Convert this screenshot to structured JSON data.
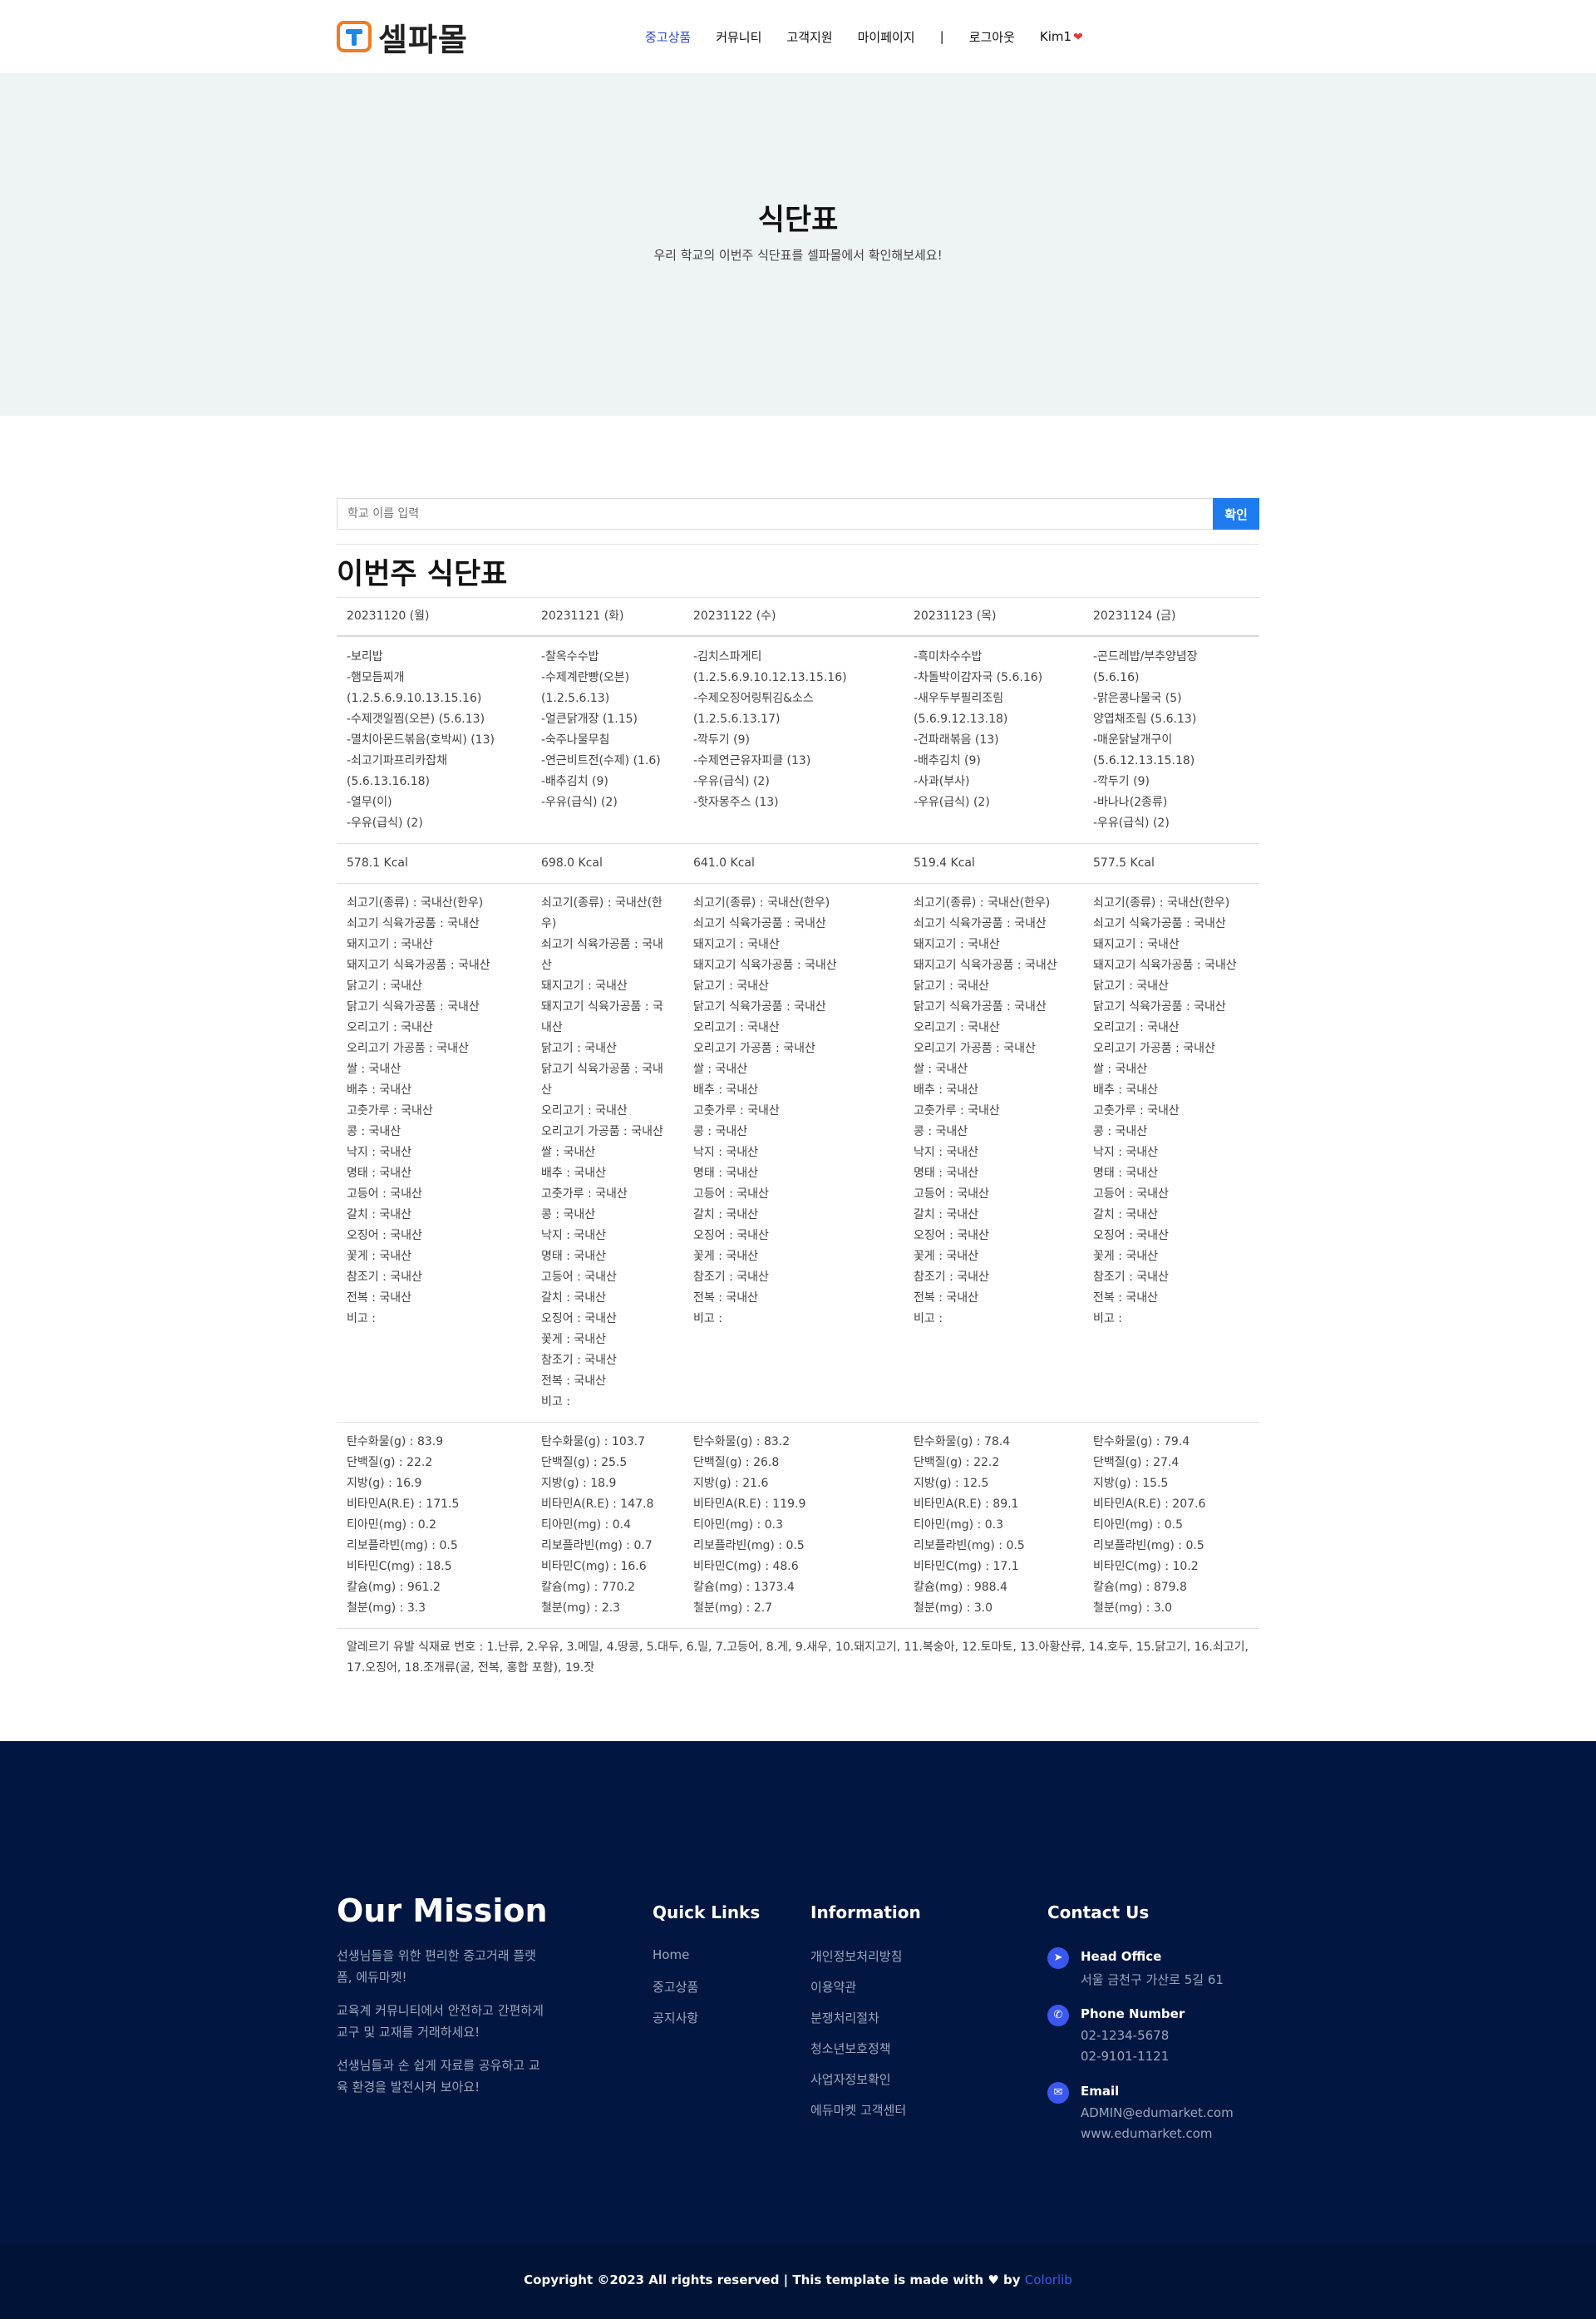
{
  "header": {
    "logo_text": "셀파몰",
    "nav": [
      "중고상품",
      "커뮤니티",
      "고객지원",
      "마이페이지",
      "|",
      "로그아웃",
      "Kim1"
    ]
  },
  "hero": {
    "title": "식단표",
    "subtitle": "우리 학교의 이번주 식단표를 셀파몰에서 확인해보세요!"
  },
  "search": {
    "placeholder": "학교 이름 입력",
    "button": "확인"
  },
  "section_title": "이번주 식단표",
  "days": [
    {
      "date": "20231120 (월)",
      "menu": [
        "-보리밥",
        "-햄모듬찌개",
        "(1.2.5.6.9.10.13.15.16)",
        "-수제갯일찜(오븐) (5.6.13)",
        "-멸치아몬드볶음(호박씨) (13)",
        "-쇠고기파프리카잡채",
        "(5.6.13.16.18)",
        "-열무(이)",
        "-우유(급식) (2)"
      ],
      "kcal": "578.1 Kcal",
      "origin": [
        "쇠고기(종류) : 국내산(한우)",
        "쇠고기 식육가공품 : 국내산",
        "돼지고기 : 국내산",
        "돼지고기 식육가공품 : 국내산",
        "닭고기 : 국내산",
        "닭고기 식육가공품 : 국내산",
        "오리고기 : 국내산",
        "오리고기 가공품 : 국내산",
        "쌀 : 국내산",
        "배추 : 국내산",
        "고춧가루 : 국내산",
        "콩 : 국내산",
        "낙지 : 국내산",
        "명태 : 국내산",
        "고등어 : 국내산",
        "갈치 : 국내산",
        "오징어 : 국내산",
        "꽃게 : 국내산",
        "참조기 : 국내산",
        "전복 : 국내산",
        "비고 :"
      ],
      "nutrition": [
        "탄수화물(g) : 83.9",
        "단백질(g) : 22.2",
        "지방(g) : 16.9",
        "비타민A(R.E) : 171.5",
        "티아민(mg) : 0.2",
        "리보플라빈(mg) : 0.5",
        "비타민C(mg) : 18.5",
        "칼슘(mg) : 961.2",
        "철분(mg) : 3.3"
      ]
    },
    {
      "date": "20231121 (화)",
      "menu": [
        "-찰옥수수밥",
        "-수제계란빵(오븐)",
        "(1.2.5.6.13)",
        "-얼큰닭개장 (1.15)",
        "-숙주나물무침",
        "-연근비트전(수제) (1.6)",
        "-배추김치 (9)",
        "-우유(급식) (2)"
      ],
      "kcal": "698.0 Kcal",
      "origin": [
        "쇠고기(종류) : 국내산(한",
        "우)",
        "쇠고기 식육가공품 : 국내",
        "산",
        "돼지고기 : 국내산",
        "돼지고기 식육가공품 : 국",
        "내산",
        "닭고기 : 국내산",
        "닭고기 식육가공품 : 국내",
        "산",
        "오리고기 : 국내산",
        "오리고기 가공품 : 국내산",
        "쌀 : 국내산",
        "배추 : 국내산",
        "고춧가루 : 국내산",
        "콩 : 국내산",
        "낙지 : 국내산",
        "명태 : 국내산",
        "고등어 : 국내산",
        "갈치 : 국내산",
        "오징어 : 국내산",
        "꽃게 : 국내산",
        "참조기 : 국내산",
        "전복 : 국내산",
        "비고 :"
      ],
      "nutrition": [
        "탄수화물(g) : 103.7",
        "단백질(g) : 25.5",
        "지방(g) : 18.9",
        "비타민A(R.E) : 147.8",
        "티아민(mg) : 0.4",
        "리보플라빈(mg) : 0.7",
        "비타민C(mg) : 16.6",
        "칼슘(mg) : 770.2",
        "철분(mg) : 2.3"
      ]
    },
    {
      "date": "20231122 (수)",
      "menu": [
        "-김치스파게티",
        "(1.2.5.6.9.10.12.13.15.16)",
        "-수제오징어링튀김&소스",
        "(1.2.5.6.13.17)",
        "-깍두기 (9)",
        "-수제연근유자피클 (13)",
        "-우유(급식) (2)",
        "-핫자몽주스 (13)"
      ],
      "kcal": "641.0 Kcal",
      "origin": [
        "쇠고기(종류) : 국내산(한우)",
        "쇠고기 식육가공품 : 국내산",
        "돼지고기 : 국내산",
        "돼지고기 식육가공품 : 국내산",
        "닭고기 : 국내산",
        "닭고기 식육가공품 : 국내산",
        "오리고기 : 국내산",
        "오리고기 가공품 : 국내산",
        "쌀 : 국내산",
        "배추 : 국내산",
        "고춧가루 : 국내산",
        "콩 : 국내산",
        "낙지 : 국내산",
        "명태 : 국내산",
        "고등어 : 국내산",
        "갈치 : 국내산",
        "오징어 : 국내산",
        "꽃게 : 국내산",
        "참조기 : 국내산",
        "전복 : 국내산",
        "비고 :"
      ],
      "nutrition": [
        "탄수화물(g) : 83.2",
        "단백질(g) : 26.8",
        "지방(g) : 21.6",
        "비타민A(R.E) : 119.9",
        "티아민(mg) : 0.3",
        "리보플라빈(mg) : 0.5",
        "비타민C(mg) : 48.6",
        "칼슘(mg) : 1373.4",
        "철분(mg) : 2.7"
      ]
    },
    {
      "date": "20231123 (목)",
      "menu": [
        "-흑미차수수밥",
        "-차돌박이감자국 (5.6.16)",
        "-새우두부필리조림",
        "(5.6.9.12.13.18)",
        "-건파래볶음 (13)",
        "-배추김치 (9)",
        "-사과(부사)",
        "-우유(급식) (2)"
      ],
      "kcal": "519.4 Kcal",
      "origin": [
        "쇠고기(종류) : 국내산(한우)",
        "쇠고기 식육가공품 : 국내산",
        "돼지고기 : 국내산",
        "돼지고기 식육가공품 : 국내산",
        "닭고기 : 국내산",
        "닭고기 식육가공품 : 국내산",
        "오리고기 : 국내산",
        "오리고기 가공품 : 국내산",
        "쌀 : 국내산",
        "배추 : 국내산",
        "고춧가루 : 국내산",
        "콩 : 국내산",
        "낙지 : 국내산",
        "명태 : 국내산",
        "고등어 : 국내산",
        "갈치 : 국내산",
        "오징어 : 국내산",
        "꽃게 : 국내산",
        "참조기 : 국내산",
        "전복 : 국내산",
        "비고 :"
      ],
      "nutrition": [
        "탄수화물(g) : 78.4",
        "단백질(g) : 22.2",
        "지방(g) : 12.5",
        "비타민A(R.E) : 89.1",
        "티아민(mg) : 0.3",
        "리보플라빈(mg) : 0.5",
        "비타민C(mg) : 17.1",
        "칼슘(mg) : 988.4",
        "철분(mg) : 3.0"
      ]
    },
    {
      "date": "20231124 (금)",
      "menu": [
        "-곤드레밥/부추양념장",
        "(5.6.16)",
        "-맑은콩나물국 (5)",
        "양엽채조림 (5.6.13)",
        "-매운닭날개구이",
        "(5.6.12.13.15.18)",
        "-깍두기 (9)",
        "-바나나(2종류)",
        "-우유(급식) (2)"
      ],
      "kcal": "577.5 Kcal",
      "origin": [
        "쇠고기(종류) : 국내산(한우)",
        "쇠고기 식육가공품 : 국내산",
        "돼지고기 : 국내산",
        "돼지고기 식육가공품 : 국내산",
        "닭고기 : 국내산",
        "닭고기 식육가공품 : 국내산",
        "오리고기 : 국내산",
        "오리고기 가공품 : 국내산",
        "쌀 : 국내산",
        "배추 : 국내산",
        "고춧가루 : 국내산",
        "콩 : 국내산",
        "낙지 : 국내산",
        "명태 : 국내산",
        "고등어 : 국내산",
        "갈치 : 국내산",
        "오징어 : 국내산",
        "꽃게 : 국내산",
        "참조기 : 국내산",
        "전복 : 국내산",
        "비고 :"
      ],
      "nutrition": [
        "탄수화물(g) : 79.4",
        "단백질(g) : 27.4",
        "지방(g) : 15.5",
        "비타민A(R.E) : 207.6",
        "티아민(mg) : 0.5",
        "리보플라빈(mg) : 0.5",
        "비타민C(mg) : 10.2",
        "칼슘(mg) : 879.8",
        "철분(mg) : 3.0"
      ]
    }
  ],
  "allergy_note": "알레르기 유발 식재료 번호 : 1.난류, 2.우유, 3.메밀, 4.땅콩, 5.대두, 6.밀, 7.고등어, 8.게, 9.새우, 10.돼지고기, 11.복숭아, 12.토마토, 13.아황산류, 14.호두, 15.닭고기, 16.쇠고기, 17.오징어, 18.조개류(굴, 전복, 홍합 포함), 19.잣",
  "footer": {
    "mission_title": "Our Mission",
    "mission_paragraphs": [
      "선생님들을 위한 편리한 중고거래 플랫폼, 에듀마켓!",
      "교육계 커뮤니티에서 안전하고 간편하게 교구 및 교재를 거래하세요!",
      "선생님들과 손 쉽게 자료를 공유하고 교육 환경을 발전시켜 보아요!"
    ],
    "quick_links_title": "Quick Links",
    "quick_links": [
      "Home",
      "중고상품",
      "공지사항"
    ],
    "information_title": "Information",
    "information_links": [
      "개인정보처리방침",
      "이용약관",
      "분쟁처리절차",
      "청소년보호정책",
      "사업자정보확인",
      "에듀마켓 고객센터"
    ],
    "contact_title": "Contact Us",
    "head_office_label": "Head Office",
    "head_office_address": "서울 금천구 가산로 5길 61",
    "phone_label": "Phone Number",
    "phone_1": "02-1234-5678",
    "phone_2": "02-9101-1121",
    "email_label": "Email",
    "email_1": "ADMIN@edumarket.com",
    "email_2": "www.edumarket.com",
    "copyright": "Copyright ©2023 All rights reserved | This template is made with ♥ by",
    "copyright_brand": "Colorlib"
  },
  "colors": {
    "accent_blue": "#1e7bf0",
    "nav_active": "#2d4bd6",
    "footer_bg": "#011640",
    "hero_bg": "#eef3f6",
    "logo_orange": "#f07b22"
  },
  "icons": [
    "location-arrow-icon",
    "phone-icon",
    "envelope-icon",
    "heart-icon"
  ]
}
